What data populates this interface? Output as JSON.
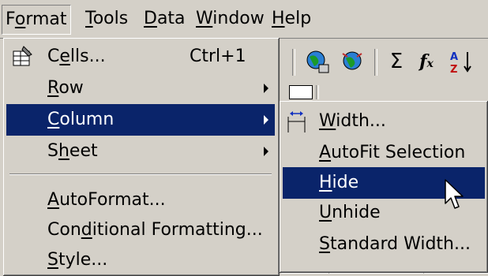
{
  "menubar": {
    "items": [
      {
        "label": "Format",
        "accel_index": 1
      },
      {
        "label": "Tools",
        "accel_index": 0
      },
      {
        "label": "Data",
        "accel_index": 0
      },
      {
        "label": "Window",
        "accel_index": 0
      },
      {
        "label": "Help",
        "accel_index": 0
      }
    ]
  },
  "toolbar": {
    "icons": [
      "web-globe-icon",
      "web-toolbar-icon",
      "autosum-icon",
      "function-icon",
      "sort-ascending-icon"
    ]
  },
  "format_menu": {
    "items": [
      {
        "pre": "C",
        "u": "e",
        "post": "lls...",
        "shortcut": "Ctrl+1",
        "icon": "format-cells-icon"
      },
      {
        "pre": "",
        "u": "R",
        "post": "ow",
        "submenu": true
      },
      {
        "pre": "",
        "u": "C",
        "post": "olumn",
        "submenu": true,
        "highlighted": true
      },
      {
        "pre": "S",
        "u": "h",
        "post": "eet",
        "submenu": true
      },
      {
        "pre": "",
        "u": "A",
        "post": "utoFormat..."
      },
      {
        "pre": "Con",
        "u": "d",
        "post": "itional Formatting..."
      },
      {
        "pre": "",
        "u": "S",
        "post": "tyle..."
      }
    ]
  },
  "column_menu": {
    "items": [
      {
        "pre": "",
        "u": "W",
        "post": "idth...",
        "icon": "column-width-icon"
      },
      {
        "pre": "",
        "u": "A",
        "post": "utoFit Selection"
      },
      {
        "pre": "",
        "u": "H",
        "post": "ide",
        "highlighted": true
      },
      {
        "pre": "",
        "u": "U",
        "post": "nhide"
      },
      {
        "pre": "",
        "u": "S",
        "post": "tandard Width..."
      }
    ]
  },
  "colors": {
    "highlight": "#0a246a",
    "face": "#d4d0c8"
  }
}
